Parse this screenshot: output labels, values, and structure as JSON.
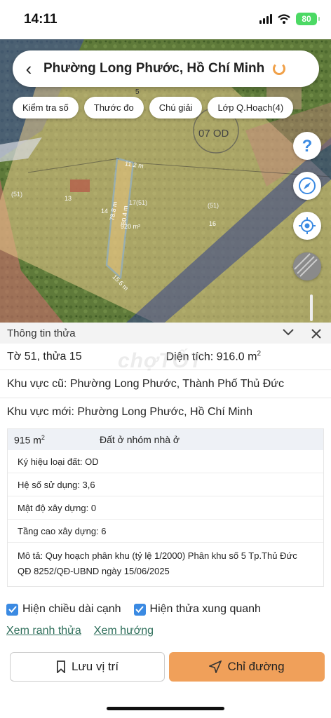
{
  "status": {
    "time": "14:11",
    "battery": "80"
  },
  "search": {
    "back_label": "‹",
    "title": "Phường Long Phước, Hồ Chí Minh"
  },
  "chips": [
    {
      "label": "Kiểm tra số"
    },
    {
      "label": "Thước đo"
    },
    {
      "label": "Chú giải"
    },
    {
      "label": "Lớp Q.Hoạch(4)"
    }
  ],
  "map_labels": {
    "top_5": "5",
    "zone": "07  OD",
    "side_top": "11.2 m",
    "side_left": "78.8 m",
    "side_right": "80.4 m",
    "side_bottom": "15.6 m",
    "plot_num": "14",
    "plot_area": "920 m²",
    "plot_label": "17(51)",
    "neighbor_13": "13",
    "neighbor_16": "16",
    "left_label": "(51)",
    "right_label": "(51)"
  },
  "panel": {
    "header_title": "Thông tin thửa",
    "sheet": "Tờ 51, thửa 15",
    "area_label": "Diện tích: 916.0 m",
    "area_unit_exp": "2",
    "old_area": "Khu vực cũ: Phường Long Phước, Thành Phố Thủ Đức",
    "new_area": "Khu vực mới: Phường Long Phước, Hồ Chí Minh",
    "watermark": "chợTỐT",
    "land": {
      "area": "915 m",
      "area_exp": "2",
      "type": "Đất ở nhóm nhà ở",
      "symbol": "Ký hiệu loại đất: OD",
      "coef": "Hệ số sử dụng: 3,6",
      "density": "Mật độ xây dựng: 0",
      "height": "Tầng cao xây dựng: 6",
      "desc_line1": "Mô tả: Quy hoạch phân khu (tỷ lệ 1/2000) Phân khu số 5 Tp.Thủ Đức",
      "desc_line2": "QĐ 8252/QĐ-UBND ngày 15/06/2025"
    },
    "check_edges": "Hiện chiều dài cạnh",
    "check_neighbors": "Hiện thửa xung quanh",
    "link_border": "Xem ranh thửa",
    "link_direction": "Xem hướng",
    "save_label": "Lưu vị trí",
    "route_label": "Chỉ đường"
  },
  "colors": {
    "accent": "#f0a05a",
    "check": "#3b8ae2",
    "link": "#2e6e5a",
    "plan_yellow": "#e8c98a"
  }
}
